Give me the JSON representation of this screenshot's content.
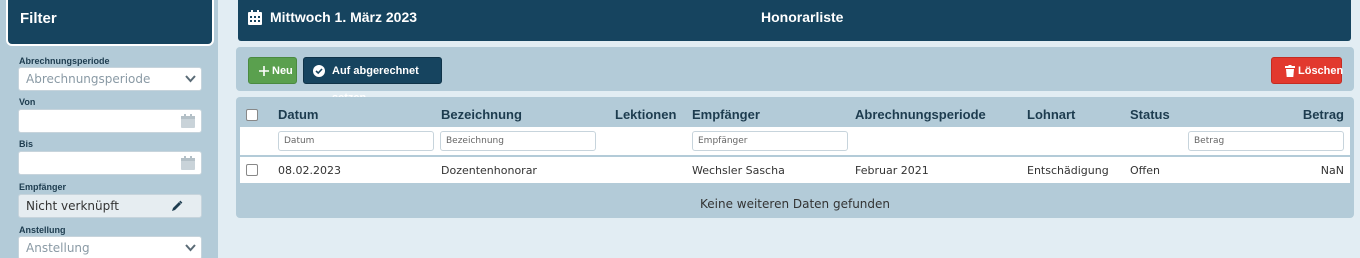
{
  "sidebar": {
    "title": "Filter",
    "fields": {
      "period_label": "Abrechnungsperiode",
      "period_value": "Abrechnungsperiode",
      "from_label": "Von",
      "to_label": "Bis",
      "recipient_label": "Empfänger",
      "recipient_value": "Nicht verknüpft",
      "employment_label": "Anstellung",
      "employment_value": "Anstellung"
    }
  },
  "header": {
    "date": "Mittwoch 1. März 2023",
    "title": "Honorarliste"
  },
  "toolbar": {
    "new_label": "Neu",
    "settle_label": "Auf abgerechnet setzen",
    "delete_label": "Löschen"
  },
  "table": {
    "columns": {
      "date": "Datum",
      "description": "Bezeichnung",
      "lessons": "Lektionen",
      "recipient": "Empfänger",
      "period": "Abrechnungsperiode",
      "wage_type": "Lohnart",
      "status": "Status",
      "amount": "Betrag"
    },
    "filters": {
      "date": "Datum",
      "description": "Bezeichnung",
      "recipient": "Empfänger",
      "amount": "Betrag"
    },
    "rows": [
      {
        "date": "08.02.2023",
        "description": "Dozentenhonorar",
        "lessons": "",
        "recipient": "Wechsler Sascha",
        "period": "Februar 2021",
        "wage_type": "Entschädigung",
        "status": "Offen",
        "amount": "NaN"
      }
    ],
    "footer": "Keine weiteren Daten gefunden"
  },
  "colors": {
    "primary": "#16445f",
    "success": "#5aa04e",
    "danger": "#e2392e",
    "panel": "#b3cbd8",
    "background": "#e2edf3"
  }
}
